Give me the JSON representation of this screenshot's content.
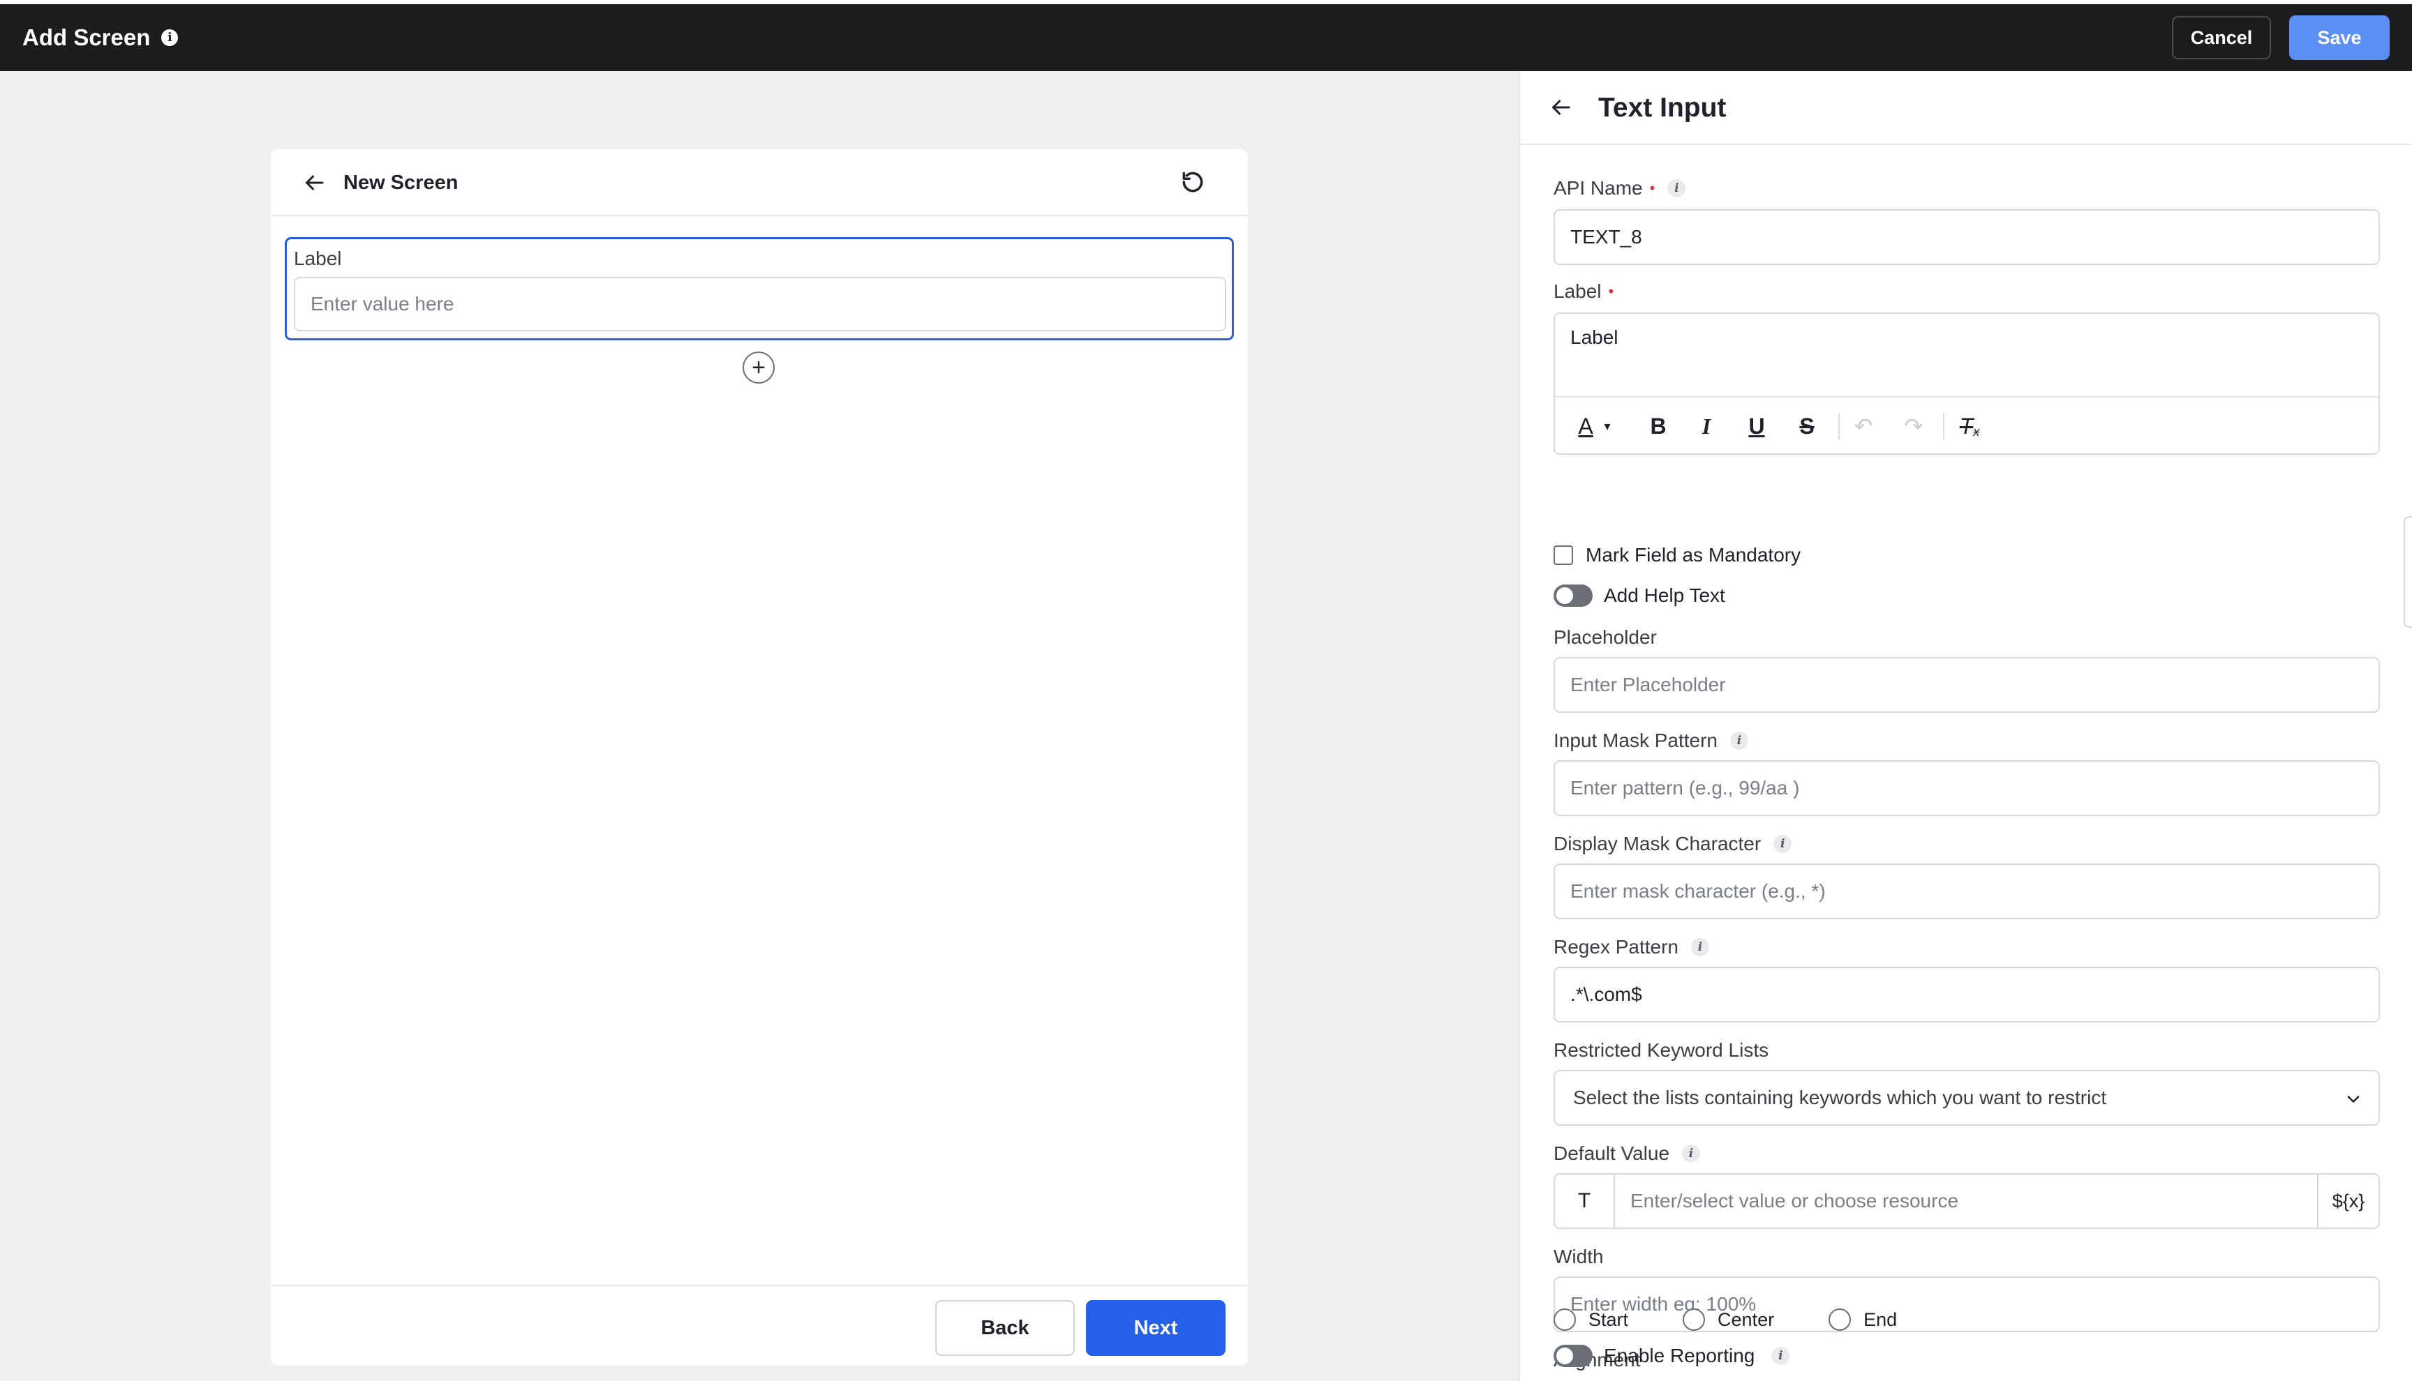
{
  "topbar": {
    "title": "Add Screen",
    "info_icon": "i",
    "cancel_label": "Cancel",
    "save_label": "Save"
  },
  "screen": {
    "title": "New Screen",
    "field": {
      "label": "Label",
      "placeholder": "Enter value here"
    },
    "add_symbol": "+",
    "back_label": "Back",
    "next_label": "Next"
  },
  "panel": {
    "title": "Text Input",
    "api_name": {
      "label": "API Name",
      "required": "•",
      "value": "TEXT_8"
    },
    "label_field": {
      "label": "Label",
      "required": "•",
      "value": "Label"
    },
    "toolbar": {
      "text_color": "A",
      "color_caret": "▾",
      "bold": "B",
      "italic": "I",
      "underline": "U",
      "strike": "S",
      "undo": "↶",
      "redo": "↷",
      "clear_format": "T",
      "clear_format_sub": "x"
    },
    "mandatory": {
      "label": "Mark Field as Mandatory",
      "checked": false
    },
    "help_text": {
      "label": "Add Help Text",
      "on": false
    },
    "placeholder": {
      "label": "Placeholder",
      "placeholder": "Enter Placeholder"
    },
    "input_mask": {
      "label": "Input Mask Pattern",
      "placeholder": "Enter pattern (e.g., 99/aa )"
    },
    "display_mask": {
      "label": "Display Mask Character",
      "placeholder": "Enter mask character (e.g., *)"
    },
    "regex": {
      "label": "Regex Pattern",
      "value": ".*\\.com$"
    },
    "restricted": {
      "label": "Restricted Keyword Lists",
      "placeholder": "Select the lists containing keywords which you want to restrict"
    },
    "default_value": {
      "label": "Default Value",
      "type_symbol": "T",
      "placeholder": "Enter/select value or choose resource",
      "variable_symbol": "${x}"
    },
    "width": {
      "label": "Width",
      "placeholder": "Enter width eg: 100%"
    },
    "alignment": {
      "label": "Alignment",
      "options": [
        "Start",
        "Center",
        "End"
      ]
    },
    "reporting": {
      "label": "Enable Reporting",
      "on": false
    },
    "info_glyph": "i"
  },
  "colors": {
    "topbar_bg": "#1b1c1e",
    "save_button": "#5b8ff3",
    "next_button": "#2560e8",
    "selected_border": "#2b5ed8",
    "required_mark": "#e0304a"
  }
}
